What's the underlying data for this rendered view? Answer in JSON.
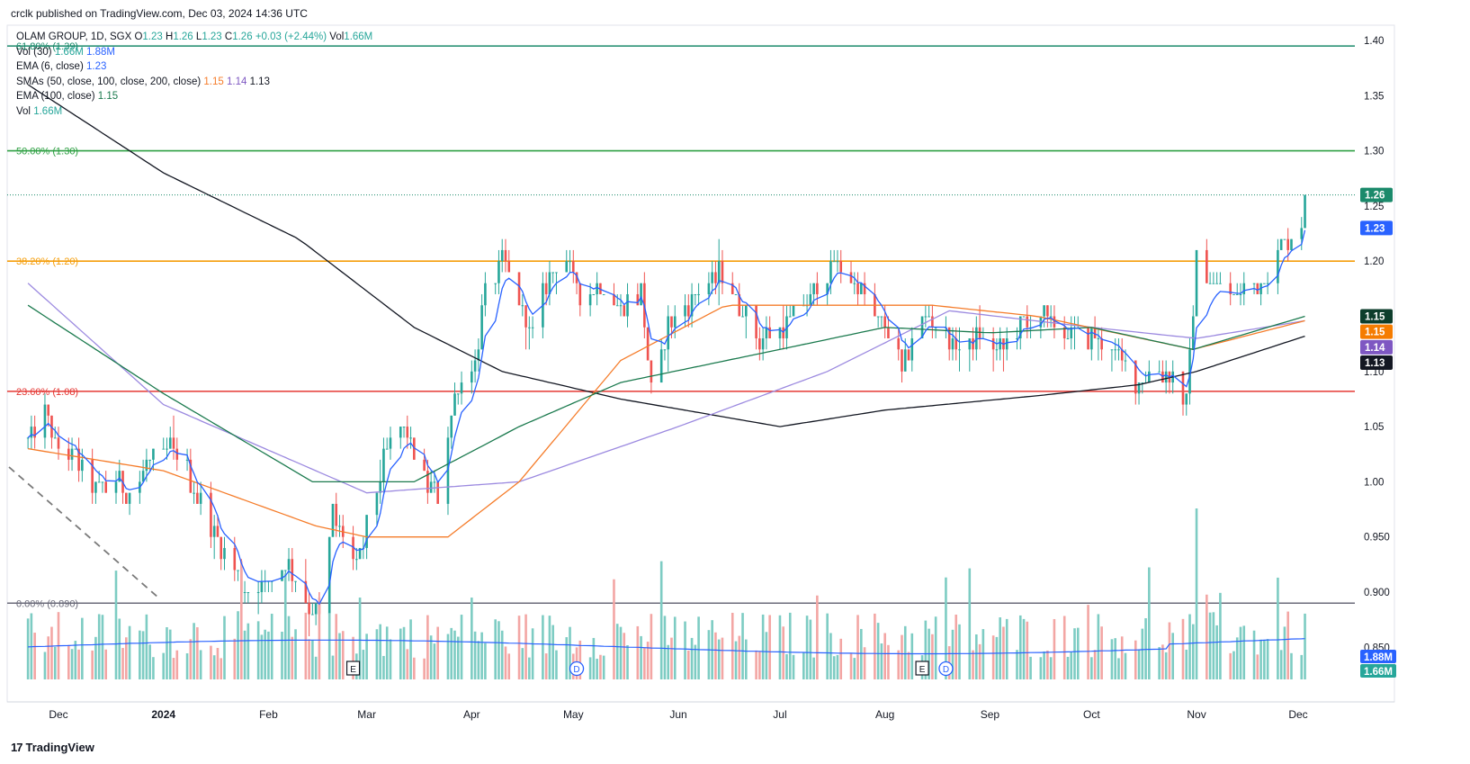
{
  "header": {
    "published": "crclk published on TradingView.com, Dec 03, 2024 14:36 UTC"
  },
  "legend": {
    "symbol_line": {
      "symbol": "OLAM GROUP, 1D, SGX",
      "o_label": "O",
      "o": "1.23",
      "h_label": "H",
      "h": "1.26",
      "l_label": "L",
      "l": "1.23",
      "c_label": "C",
      "c": "1.26",
      "change": "+0.03 (+2.44%)",
      "vol_label": "Vol",
      "vol": "1.66M"
    },
    "vol30": {
      "label": "Vol (30)",
      "v1": "1.66M",
      "v2": "1.88M"
    },
    "ema6": {
      "label": "EMA (6, close)",
      "v": "1.23"
    },
    "smas": {
      "label": "SMAs (50, close, 100, close, 200, close)",
      "v1": "1.15",
      "v2": "1.14",
      "v3": "1.13"
    },
    "ema100": {
      "label": "EMA (100, close)",
      "v": "1.15"
    },
    "vol": {
      "label": "Vol",
      "v": "1.66M"
    }
  },
  "footer": {
    "brand": "TradingView",
    "logo_mark": "17"
  },
  "colors": {
    "up": "#26a69a",
    "down": "#ef5350",
    "ema6": "#2962ff",
    "sma50": "#f57c2a",
    "sma100": "#9c8ae0",
    "sma200": "#131722",
    "ema100": "#1b7a4e",
    "fib_618": "#1b8a6b",
    "fib_50": "#2ea043",
    "fib_382": "#f59e0b",
    "fib_236": "#e53935",
    "fib_0": "#6b6b7a"
  },
  "chart_data": {
    "type": "candlestick",
    "title": "OLAM GROUP, 1D, SGX",
    "x_ticks": [
      "Dec",
      "2024",
      "Feb",
      "Mar",
      "Apr",
      "May",
      "Jun",
      "Jul",
      "Aug",
      "Sep",
      "Oct",
      "Nov",
      "Dec"
    ],
    "y_ticks": [
      "1.40",
      "1.35",
      "1.30",
      "1.25",
      "1.20",
      "1.15",
      "1.10",
      "1.05",
      "1.00",
      "0.950",
      "0.900",
      "0.850"
    ],
    "ylim": [
      0.845,
      1.405
    ],
    "fib_levels": [
      {
        "label": "61.80% (1.39)",
        "value": 1.395,
        "color": "#1b8a6b"
      },
      {
        "label": "50.00% (1.30)",
        "value": 1.3,
        "color": "#2ea043"
      },
      {
        "label": "38.20% (1.20)",
        "value": 1.2,
        "color": "#f59e0b"
      },
      {
        "label": "23.60% (1.08)",
        "value": 1.082,
        "color": "#e53935"
      },
      {
        "label": "0.00% (0.890)",
        "value": 0.89,
        "color": "#6b6b7a"
      }
    ],
    "last_price_line": 1.26,
    "price_tags": [
      {
        "text": "1.26",
        "value": 1.26,
        "color": "#1b8a6b"
      },
      {
        "text": "1.23",
        "value": 1.23,
        "color": "#2962ff"
      },
      {
        "text": "1.15",
        "value": 1.15,
        "color": "#0d3d2c"
      },
      {
        "text": "1.15",
        "value": 1.136,
        "color": "#f57c00"
      },
      {
        "text": "1.14",
        "value": 1.122,
        "color": "#7e57c2"
      },
      {
        "text": "1.13",
        "value": 1.108,
        "color": "#131722"
      }
    ],
    "volume_tags": [
      {
        "text": "1.88M",
        "color": "#2962ff"
      },
      {
        "text": "1.66M",
        "color": "#26a69a"
      }
    ],
    "events": [
      {
        "glyph": "E",
        "date": "2024-02-26"
      },
      {
        "glyph": "D",
        "date": "2024-05-02"
      },
      {
        "glyph": "E",
        "date": "2024-08-12"
      },
      {
        "glyph": "D",
        "date": "2024-08-19"
      }
    ],
    "close_anchors": [
      [
        "2023-11-22",
        1.04
      ],
      [
        "2023-11-27",
        1.06
      ],
      [
        "2023-12-01",
        1.03
      ],
      [
        "2023-12-06",
        1.02
      ],
      [
        "2023-12-12",
        0.99
      ],
      [
        "2023-12-18",
        1.0
      ],
      [
        "2023-12-22",
        0.99
      ],
      [
        "2023-12-28",
        1.02
      ],
      [
        "2024-01-03",
        1.03
      ],
      [
        "2024-01-08",
        1.01
      ],
      [
        "2024-01-12",
        0.98
      ],
      [
        "2024-01-17",
        0.95
      ],
      [
        "2024-01-22",
        0.92
      ],
      [
        "2024-01-26",
        0.9
      ],
      [
        "2024-02-01",
        0.91
      ],
      [
        "2024-02-06",
        0.93
      ],
      [
        "2024-02-12",
        0.89
      ],
      [
        "2024-02-16",
        0.88
      ],
      [
        "2024-02-20",
        0.97
      ],
      [
        "2024-02-23",
        0.95
      ],
      [
        "2024-02-27",
        0.92
      ],
      [
        "2024-03-01",
        0.96
      ],
      [
        "2024-03-06",
        1.02
      ],
      [
        "2024-03-12",
        1.05
      ],
      [
        "2024-03-18",
        1.0
      ],
      [
        "2024-03-22",
        0.99
      ],
      [
        "2024-03-27",
        1.08
      ],
      [
        "2024-04-02",
        1.11
      ],
      [
        "2024-04-05",
        1.17
      ],
      [
        "2024-04-10",
        1.2
      ],
      [
        "2024-04-15",
        1.16
      ],
      [
        "2024-04-19",
        1.13
      ],
      [
        "2024-04-24",
        1.19
      ],
      [
        "2024-04-29",
        1.2
      ],
      [
        "2024-05-03",
        1.17
      ],
      [
        "2024-05-09",
        1.18
      ],
      [
        "2024-05-15",
        1.16
      ],
      [
        "2024-05-21",
        1.17
      ],
      [
        "2024-05-24",
        1.08
      ],
      [
        "2024-05-29",
        1.14
      ],
      [
        "2024-06-04",
        1.16
      ],
      [
        "2024-06-10",
        1.18
      ],
      [
        "2024-06-14",
        1.19
      ],
      [
        "2024-06-19",
        1.16
      ],
      [
        "2024-06-25",
        1.13
      ],
      [
        "2024-07-01",
        1.14
      ],
      [
        "2024-07-05",
        1.15
      ],
      [
        "2024-07-11",
        1.17
      ],
      [
        "2024-07-17",
        1.2
      ],
      [
        "2024-07-23",
        1.18
      ],
      [
        "2024-07-29",
        1.15
      ],
      [
        "2024-08-02",
        1.14
      ],
      [
        "2024-08-06",
        1.1
      ],
      [
        "2024-08-09",
        1.13
      ],
      [
        "2024-08-13",
        1.15
      ],
      [
        "2024-08-19",
        1.13
      ],
      [
        "2024-08-23",
        1.12
      ],
      [
        "2024-08-29",
        1.13
      ],
      [
        "2024-09-04",
        1.12
      ],
      [
        "2024-09-10",
        1.14
      ],
      [
        "2024-09-16",
        1.15
      ],
      [
        "2024-09-20",
        1.14
      ],
      [
        "2024-09-26",
        1.13
      ],
      [
        "2024-10-02",
        1.13
      ],
      [
        "2024-10-08",
        1.12
      ],
      [
        "2024-10-14",
        1.09
      ],
      [
        "2024-10-18",
        1.1
      ],
      [
        "2024-10-24",
        1.1
      ],
      [
        "2024-10-29",
        1.07
      ],
      [
        "2024-11-01",
        1.2
      ],
      [
        "2024-11-06",
        1.18
      ],
      [
        "2024-11-12",
        1.17
      ],
      [
        "2024-11-18",
        1.18
      ],
      [
        "2024-11-22",
        1.19
      ],
      [
        "2024-11-27",
        1.22
      ],
      [
        "2024-12-02",
        1.23
      ],
      [
        "2024-12-03",
        1.26
      ]
    ],
    "ma_anchors": {
      "ema100": [
        [
          "2023-11-22",
          1.16
        ],
        [
          "2024-01-01",
          1.08
        ],
        [
          "2024-02-14",
          1.0
        ],
        [
          "2024-03-15",
          1.0
        ],
        [
          "2024-04-15",
          1.05
        ],
        [
          "2024-05-15",
          1.09
        ],
        [
          "2024-07-01",
          1.12
        ],
        [
          "2024-08-01",
          1.14
        ],
        [
          "2024-09-01",
          1.135
        ],
        [
          "2024-10-01",
          1.14
        ],
        [
          "2024-10-31",
          1.12
        ],
        [
          "2024-12-03",
          1.15
        ]
      ],
      "sma50": [
        [
          "2023-11-22",
          1.03
        ],
        [
          "2024-01-01",
          1.01
        ],
        [
          "2024-02-15",
          0.96
        ],
        [
          "2024-03-01",
          0.95
        ],
        [
          "2024-03-25",
          0.95
        ],
        [
          "2024-04-15",
          1.0
        ],
        [
          "2024-05-15",
          1.11
        ],
        [
          "2024-06-15",
          1.16
        ],
        [
          "2024-08-15",
          1.16
        ],
        [
          "2024-09-15",
          1.15
        ],
        [
          "2024-10-31",
          1.12
        ],
        [
          "2024-12-03",
          1.146
        ]
      ],
      "sma100": [
        [
          "2023-11-22",
          1.18
        ],
        [
          "2024-01-01",
          1.07
        ],
        [
          "2024-03-01",
          0.99
        ],
        [
          "2024-04-15",
          1.0
        ],
        [
          "2024-06-01",
          1.05
        ],
        [
          "2024-07-15",
          1.1
        ],
        [
          "2024-08-20",
          1.155
        ],
        [
          "2024-10-01",
          1.14
        ],
        [
          "2024-11-01",
          1.13
        ],
        [
          "2024-12-03",
          1.146
        ]
      ],
      "sma200": [
        [
          "2023-11-22",
          1.36
        ],
        [
          "2024-01-01",
          1.28
        ],
        [
          "2024-02-10",
          1.22
        ],
        [
          "2024-03-15",
          1.14
        ],
        [
          "2024-04-10",
          1.1
        ],
        [
          "2024-05-15",
          1.075
        ],
        [
          "2024-07-01",
          1.05
        ],
        [
          "2024-08-01",
          1.065
        ],
        [
          "2024-09-15",
          1.078
        ],
        [
          "2024-10-15",
          1.088
        ],
        [
          "2024-11-01",
          1.1
        ],
        [
          "2024-12-03",
          1.132
        ]
      ]
    },
    "volume_spike_date": "2024-11-01"
  }
}
